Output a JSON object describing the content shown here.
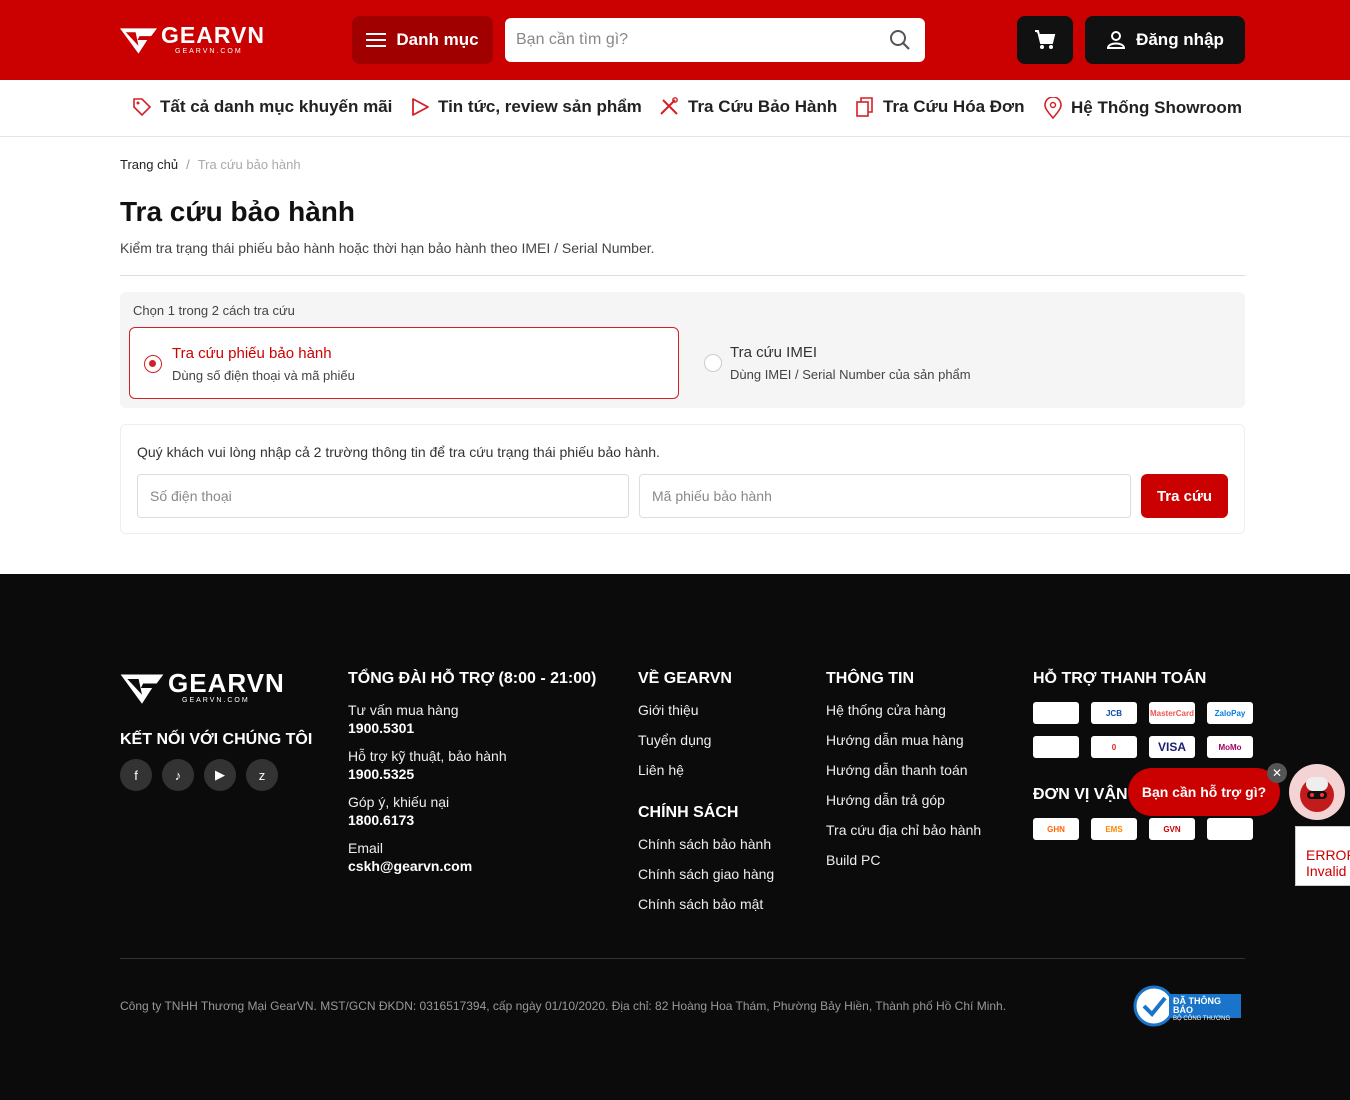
{
  "header": {
    "brand": "GEARVN",
    "brand_sub": "GEARVN.COM",
    "menu_label": "Danh mục",
    "search_placeholder": "Bạn cần tìm gì?",
    "login_label": "Đăng nhập",
    "accent_color": "#cb0000"
  },
  "subnav": {
    "items": [
      {
        "label": "Tất cả danh mục khuyến mãi",
        "icon": "tag-icon"
      },
      {
        "label": "Tin tức, review sản phẩm",
        "icon": "play-icon"
      },
      {
        "label": "Tra Cứu Bảo Hành",
        "icon": "tools-icon"
      },
      {
        "label": "Tra Cứu Hóa Đơn",
        "icon": "documents-icon"
      },
      {
        "label": "Hệ Thống Showroom",
        "icon": "location-pin-icon"
      }
    ]
  },
  "breadcrumb": {
    "home": "Trang chủ",
    "separator": "/",
    "current": "Tra cứu bảo hành"
  },
  "page": {
    "title": "Tra cứu bảo hành",
    "description": "Kiểm tra trạng thái phiếu bảo hành hoặc thời hạn bảo hành theo IMEI / Serial Number."
  },
  "lookup": {
    "choose_label": "Chọn 1 trong 2 cách tra cứu",
    "options": [
      {
        "title": "Tra cứu phiếu bảo hành",
        "subtitle": "Dùng số điện thoại và mã phiếu",
        "selected": true
      },
      {
        "title": "Tra cứu IMEI",
        "subtitle": "Dùng IMEI / Serial Number của sản phẩm",
        "selected": false
      }
    ],
    "note": "Quý khách vui lòng nhập cả 2 trường thông tin để tra cứu trạng thái phiếu bảo hành.",
    "phone_placeholder": "Số điện thoại",
    "ticket_placeholder": "Mã phiếu bảo hành",
    "submit_label": "Tra cứu"
  },
  "footer": {
    "brand": "GEARVN",
    "brand_sub": "GEARVN.COM",
    "connect_heading": "KẾT NỐI VỚI CHÚNG TÔI",
    "socials": [
      "facebook-icon",
      "tiktok-icon",
      "youtube-icon",
      "zalo-icon"
    ],
    "support": {
      "heading": "TỔNG ĐÀI HỖ TRỢ (8:00 - 21:00)",
      "items": [
        {
          "label": "Tư vấn mua hàng",
          "value": "1900.5301"
        },
        {
          "label": "Hỗ trợ kỹ thuật, bảo hành",
          "value": "1900.5325"
        },
        {
          "label": "Góp ý, khiếu nại",
          "value": "1800.6173"
        },
        {
          "label": "Email",
          "value": "cskh@gearvn.com"
        }
      ]
    },
    "about": {
      "heading": "VỀ GEARVN",
      "links": [
        "Giới thiệu",
        "Tuyển dụng",
        "Liên hệ"
      ]
    },
    "policy": {
      "heading": "CHÍNH SÁCH",
      "links": [
        "Chính sách bảo hành",
        "Chính sách giao hàng",
        "Chính sách bảo mật"
      ]
    },
    "info": {
      "heading": "THÔNG TIN",
      "links": [
        "Hệ thống cửa hàng",
        "Hướng dẫn mua hàng",
        "Hướng dẫn thanh toán",
        "Hướng dẫn trả góp",
        "Tra cứu địa chỉ bảo hành",
        "Build PC"
      ]
    },
    "payment": {
      "heading": "HỖ TRỢ THANH TOÁN",
      "methods": [
        "",
        "JCB",
        "MasterCard",
        "ZaloPay",
        "",
        "0",
        "VISA",
        "MoMo"
      ]
    },
    "shipping": {
      "heading": "ĐƠN VỊ VẬN",
      "carriers": [
        "GHN",
        "EMS",
        "GVN",
        ""
      ]
    },
    "company": "Công ty TNHH Thương Mại GearVN. MST/GCN ĐKDN: 0316517394, cấp ngày 01/10/2020. Địa chỉ: 82 Hoàng Hoa Thám, Phường Bảy Hiền, Thành phố Hồ Chí Minh.",
    "badge_line1": "ĐÃ THÔNG BÁO",
    "badge_line2": "BỘ CÔNG THƯƠNG"
  },
  "chat": {
    "bubble_text": "Bạn cần hỗ trợ gì?",
    "close_glyph": "✕"
  },
  "error_widget": {
    "line1": "ERROR",
    "line2": "Invalid"
  }
}
